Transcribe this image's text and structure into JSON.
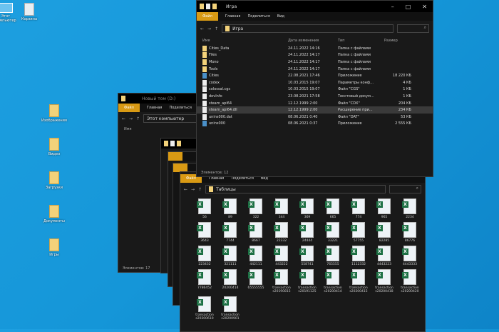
{
  "desktop": [
    {
      "label": "Этот компьютер"
    },
    {
      "label": "Корзина"
    },
    {
      "label": "Изображения"
    },
    {
      "label": "Видео"
    },
    {
      "label": "Загрузки"
    },
    {
      "label": "Документы"
    },
    {
      "label": "Игры"
    }
  ],
  "ribbon": {
    "file": "Файл",
    "home": "Главная",
    "share": "Поделиться",
    "view": "Вид"
  },
  "back_window": {
    "title": "Новый том (D:)",
    "address": "Этот компьютер",
    "col_name": "Имя",
    "status": "Элементов: 17"
  },
  "game_window": {
    "title": "Игра",
    "address": "Игра",
    "columns": [
      "Имя",
      "Дата изменения",
      "Тип",
      "Размер"
    ],
    "rows": [
      {
        "name": "Cities_Data",
        "date": "24.11.2022 14:16",
        "type": "Папка с файлами",
        "size": "",
        "icon": "folder"
      },
      {
        "name": "Files",
        "date": "24.11.2022 14:17",
        "type": "Папка с файлами",
        "size": "",
        "icon": "folder"
      },
      {
        "name": "Mono",
        "date": "24.11.2022 14:17",
        "type": "Папка с файлами",
        "size": "",
        "icon": "folder"
      },
      {
        "name": "Tools",
        "date": "24.11.2022 14:17",
        "type": "Папка с файлами",
        "size": "",
        "icon": "folder"
      },
      {
        "name": "Cities",
        "date": "22.08.2021 17:46",
        "type": "Приложение",
        "size": "18 220 КБ",
        "icon": "app"
      },
      {
        "name": "codex",
        "date": "10.03.2015 19:07",
        "type": "Параметры конф...",
        "size": "4 КБ",
        "icon": "file"
      },
      {
        "name": "colossal.cgs",
        "date": "10.03.2015 19:07",
        "type": "Файл \"CGS\"",
        "size": "1 КБ",
        "icon": "file"
      },
      {
        "name": "devInfo",
        "date": "23.08.2021 17:58",
        "type": "Текстовый докум...",
        "size": "1 КБ",
        "icon": "file"
      },
      {
        "name": "steam_api64",
        "date": "12.12.1999 2:00",
        "type": "Файл \"CDX\"",
        "size": "204 КБ",
        "icon": "file"
      },
      {
        "name": "steam_api64.dll",
        "date": "12.12.1999 2:00",
        "type": "Расширение при...",
        "size": "234 КБ",
        "icon": "file",
        "selected": true
      },
      {
        "name": "unins000.dat",
        "date": "08.06.2021 0:40",
        "type": "Файл \"DAT\"",
        "size": "53 КБ",
        "icon": "file"
      },
      {
        "name": "unins000",
        "date": "08.06.2021 0:37",
        "type": "Приложение",
        "size": "2 555 КБ",
        "icon": "app"
      }
    ],
    "status": "Элементов: 12"
  },
  "tables_window": {
    "address": "Таблицы",
    "files": [
      "56",
      "89",
      "322",
      "344",
      "369",
      "665",
      "774",
      "965",
      "2234",
      "3643",
      "7744",
      "8667",
      "22332",
      "24444",
      "33221",
      "57755",
      "82285",
      "86776",
      "223432",
      "321111",
      "442111",
      "443222",
      "558741",
      "765555",
      "1112332",
      "4443223",
      "4443333",
      "7786452",
      "20200414",
      "65555555",
      "transaction s20190815",
      "transaction s20191125",
      "transaction s20200414",
      "transaction s20200415",
      "transaction s20200418",
      "transaction s20200420",
      "transaction s20200610",
      "transaction s20200901"
    ]
  }
}
